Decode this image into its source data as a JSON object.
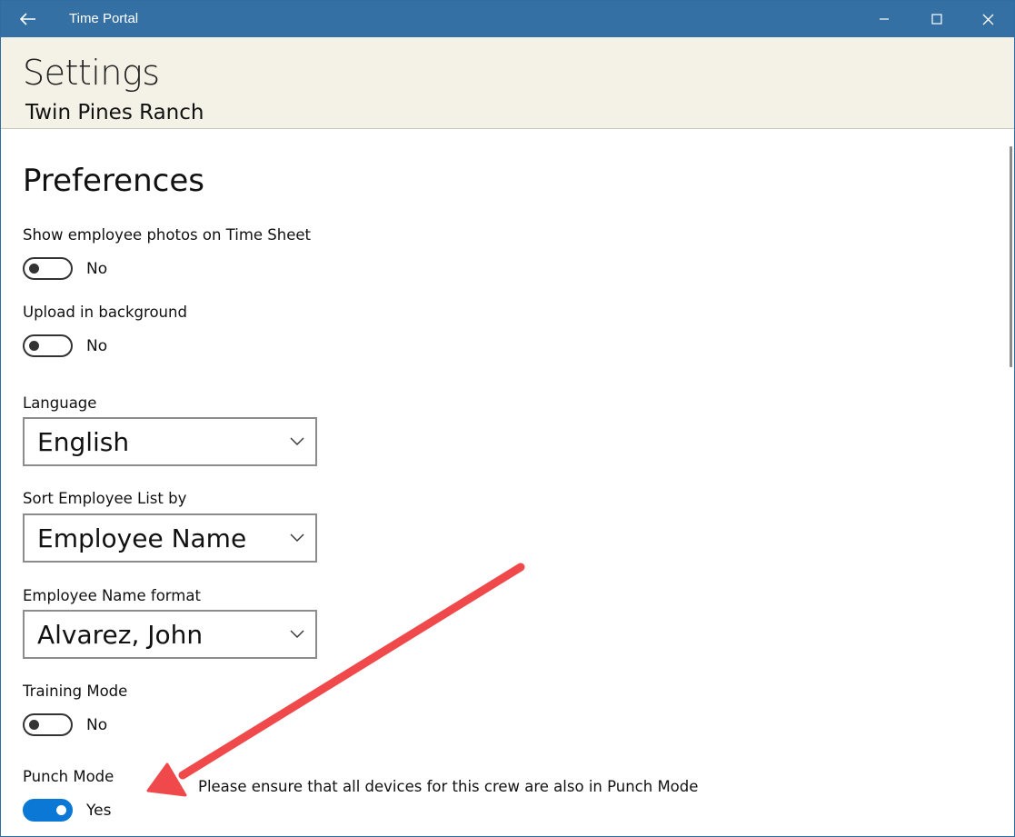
{
  "window": {
    "title": "Time Portal",
    "back_icon": "arrow-left-icon",
    "controls": [
      "minimize-icon",
      "maximize-icon",
      "close-icon"
    ]
  },
  "header": {
    "title": "Settings",
    "subtitle": "Twin Pines Ranch",
    "background_color": "#f4f1e6"
  },
  "preferences": {
    "title": "Preferences",
    "show_photos": {
      "label": "Show employee photos on Time Sheet",
      "state": "No",
      "on": false
    },
    "upload_background": {
      "label": "Upload in background",
      "state": "No",
      "on": false
    },
    "language": {
      "label": "Language",
      "value": "English"
    },
    "sort_list": {
      "label": "Sort Employee List by",
      "value": "Employee Name"
    },
    "name_format": {
      "label": "Employee Name format",
      "value": "Alvarez, John"
    },
    "training_mode": {
      "label": "Training Mode",
      "state": "No",
      "on": false
    },
    "punch_mode": {
      "label": "Punch Mode",
      "state": "Yes",
      "on": true
    }
  },
  "annotation": {
    "note": "Please ensure that all devices for this crew are also in Punch Mode",
    "arrow_color": "#f0494b"
  },
  "colors": {
    "titlebar": "#3570a4",
    "toggle_on": "#0a78d4"
  }
}
